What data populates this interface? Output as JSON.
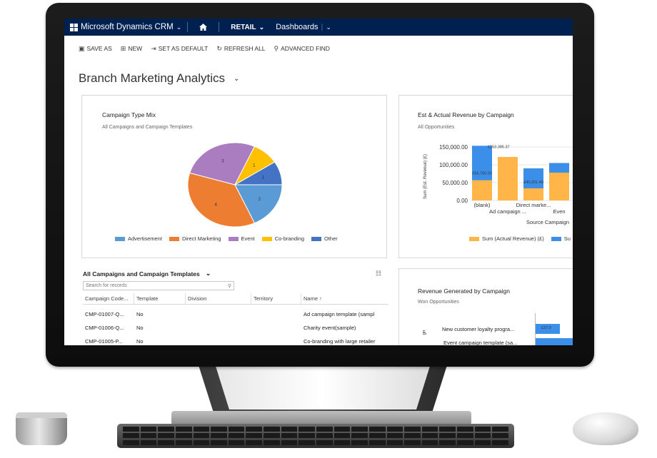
{
  "nav": {
    "brand": "Microsoft Dynamics CRM",
    "area": "RETAIL",
    "section": "Dashboards"
  },
  "commands": {
    "save_as": "SAVE AS",
    "new": "NEW",
    "set_default": "SET AS DEFAULT",
    "refresh_all": "REFRESH ALL",
    "advanced_find": "ADVANCED FIND"
  },
  "page_title": "Branch Marketing Analytics",
  "campaign_mix": {
    "title": "Campaign Type Mix",
    "subtitle": "All Campaigns and Campaign Templates",
    "legend": [
      "Advertisement",
      "Direct Marketing",
      "Event",
      "Co-branding",
      "Other"
    ]
  },
  "revenue_chart": {
    "title": "Est & Actual Revenue by Campaign",
    "subtitle": "All Opportunities",
    "ylabel": "Sum (Est. Revenue) (£)",
    "xlabel": "Source Campaign",
    "legend": [
      "Sum (Actual Revenue) (£)",
      "Su"
    ]
  },
  "won_chart": {
    "title": "Revenue Generated by Campaign",
    "subtitle": "Won Opportunities",
    "rows": [
      "New customer loyalty progra...",
      "Event campaign template (sa..."
    ],
    "values": [
      "£37,0"
    ],
    "ylabel": "gn"
  },
  "grid": {
    "title": "All Campaigns and Campaign Templates",
    "search_placeholder": "Search for records",
    "columns": [
      "Campaign Code...",
      "Template",
      "Division",
      "Territory",
      "Name ↑"
    ],
    "rows": [
      {
        "code": "CMP-01007-Q...",
        "template": "No",
        "name": "Ad campaign template (sampl"
      },
      {
        "code": "CMP-01006-Q...",
        "template": "No",
        "name": "Charity event(sample)"
      },
      {
        "code": "CMP-01005-P...",
        "template": "No",
        "name": "Co-branding with large retailer"
      }
    ]
  },
  "chart_data": [
    {
      "type": "pie",
      "title": "Campaign Type Mix",
      "categories": [
        "Advertisement",
        "Direct Marketing",
        "Event",
        "Co-branding",
        "Other"
      ],
      "values": [
        2,
        4,
        3,
        1,
        1
      ],
      "colors": [
        "#5b9bd5",
        "#ed7d31",
        "#a97dbf",
        "#ffc000",
        "#4472c4"
      ]
    },
    {
      "type": "bar",
      "title": "Est & Actual Revenue by Campaign",
      "ylabel": "Sum (Est. Revenue) (£)",
      "xlabel": "Source Campaign",
      "categories": [
        "(blank)",
        "Ad campaign ...",
        "Direct marke...",
        "Even"
      ],
      "ylim": [
        0,
        150000
      ],
      "yticks": [
        "0.00",
        "50,000.00",
        "100,000.00",
        "150,000.00"
      ],
      "series": [
        {
          "name": "Sum (Actual Revenue) (£)",
          "values": [
            56750,
            122000,
            34000,
            78000
          ],
          "color": "#ffb547"
        },
        {
          "name": "Su",
          "values": [
            153385.37,
            0,
            90000,
            105000
          ],
          "color": "#3c8fe8"
        }
      ],
      "labels": [
        "£153,385.37",
        "£56,750.00",
        "£40,201.49"
      ]
    }
  ]
}
